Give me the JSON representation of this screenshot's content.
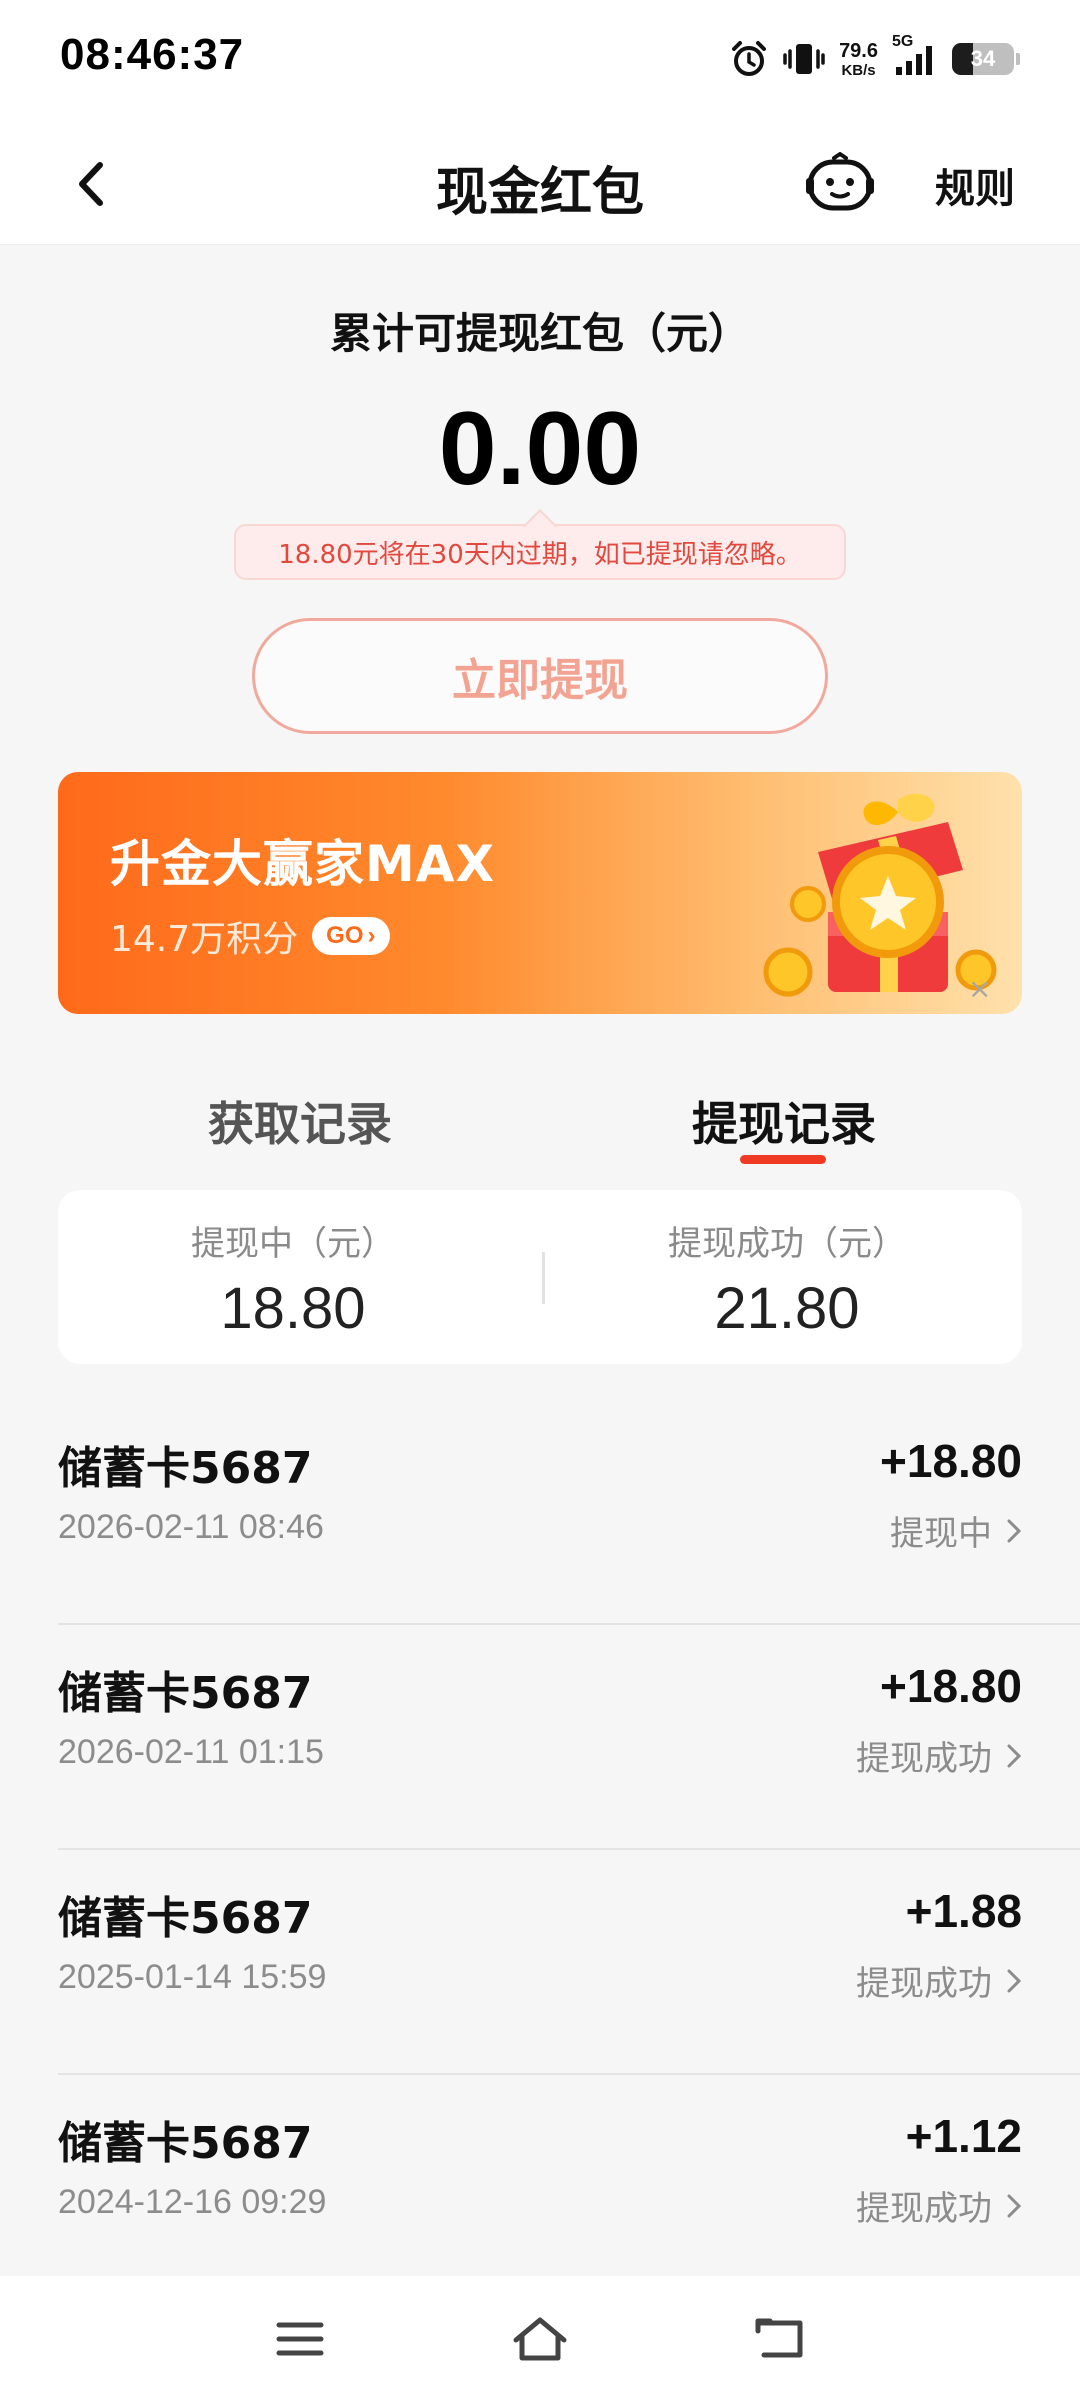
{
  "status_bar": {
    "time": "08:46:37",
    "net_speed_value": "79.6",
    "net_speed_unit": "KB/s",
    "network": "5G",
    "battery": "34",
    "battery_level": 0.34
  },
  "nav": {
    "title": "现金红包",
    "rules_label": "规则"
  },
  "summary": {
    "label": "累计可提现红包（元）",
    "amount": "0.00",
    "expiry_tip": "18.80元将在30天内过期，如已提现请忽略。",
    "withdraw_button": "立即提现"
  },
  "promo": {
    "title": "升金大赢家MAX",
    "subtitle": "14.7万积分",
    "go_label": "GO",
    "close": "×"
  },
  "tabs": {
    "items": [
      {
        "label": "获取记录",
        "active": false
      },
      {
        "label": "提现记录",
        "active": true
      }
    ]
  },
  "stats": {
    "pending_label": "提现中（元）",
    "pending_value": "18.80",
    "success_label": "提现成功（元）",
    "success_value": "21.80"
  },
  "records": [
    {
      "title": "储蓄卡5687",
      "time": "2026-02-11 08:46",
      "amount": "+18.80",
      "status": "提现中"
    },
    {
      "title": "储蓄卡5687",
      "time": "2026-02-11 01:15",
      "amount": "+18.80",
      "status": "提现成功"
    },
    {
      "title": "储蓄卡5687",
      "time": "2025-01-14 15:59",
      "amount": "+1.88",
      "status": "提现成功"
    },
    {
      "title": "储蓄卡5687",
      "time": "2024-12-16 09:29",
      "amount": "+1.12",
      "status": "提现成功"
    }
  ],
  "colors": {
    "accent": "#f03b24",
    "tip_text": "#e2483d",
    "button_text": "#f3a391",
    "promo_start": "#ff6a1a",
    "promo_end": "#ffe1ac"
  },
  "icons": {
    "back": "chevron-left-icon",
    "service": "robot-service-icon",
    "record_arrow": "chevron-right-icon",
    "sys_menu": "menu-icon",
    "sys_home": "home-icon",
    "sys_back": "back-icon"
  }
}
